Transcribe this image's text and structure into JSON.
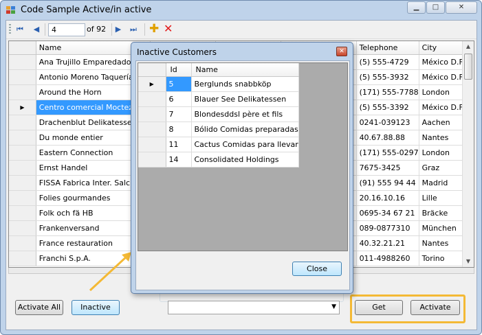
{
  "window": {
    "title": "Code Sample Active/in active",
    "buttons": {
      "minimize": "▁",
      "maximize": "□",
      "close": "✕"
    }
  },
  "navigator": {
    "position": "4",
    "count_label": "of 92",
    "icons": [
      "first-icon",
      "prev-icon",
      "next-icon",
      "last-icon",
      "add-icon",
      "delete-icon"
    ]
  },
  "grid": {
    "columns": [
      "Name",
      "",
      "",
      "",
      "Telephone",
      "City"
    ],
    "current_row": 3,
    "rows": [
      {
        "name": "Ana Trujillo Emparedados y h",
        "telephone": "(5) 555-4729",
        "city": "México D.F."
      },
      {
        "name": "Antonio Moreno Taquería",
        "telephone": "(5) 555-3932",
        "city": "México D.F."
      },
      {
        "name": "Around the Horn",
        "telephone": "(171) 555-7788",
        "city": "London"
      },
      {
        "name": "Centro comercial Moctezuma",
        "telephone": "(5) 555-3392",
        "city": "México D.F."
      },
      {
        "name": "Drachenblut Delikatessen",
        "telephone": "0241-039123",
        "city": "Aachen"
      },
      {
        "name": "Du monde entier",
        "telephone": "40.67.88.88",
        "city": "Nantes"
      },
      {
        "name": "Eastern Connection",
        "telephone": "(171) 555-0297",
        "city": "London"
      },
      {
        "name": "Ernst Handel",
        "telephone": "7675-3425",
        "city": "Graz"
      },
      {
        "name": "FISSA Fabrica Inter. Salchich",
        "telephone": "(91) 555 94 44",
        "city": "Madrid"
      },
      {
        "name": "Folies gourmandes",
        "telephone": "20.16.10.16",
        "city": "Lille"
      },
      {
        "name": "Folk och fä HB",
        "telephone": "0695-34 67 21",
        "city": "Bräcke"
      },
      {
        "name": "Frankenversand",
        "telephone": "089-0877310",
        "city": "München"
      },
      {
        "name": "France restauration",
        "telephone": "40.32.21.21",
        "city": "Nantes"
      },
      {
        "name": "Franchi S.p.A.",
        "telephone": "011-4988260",
        "city": "Torino"
      }
    ]
  },
  "buttons": {
    "activate_all": "Activate All",
    "inactive": "Inactive",
    "get": "Get",
    "activate": "Activate"
  },
  "groupbox_title": "",
  "combo_value": "",
  "dialog": {
    "title": "Inactive Customers",
    "close_glyph": "✕",
    "columns": [
      "Id",
      "Name"
    ],
    "rows": [
      {
        "id": "5",
        "name": "Berglunds snabbköp"
      },
      {
        "id": "6",
        "name": "Blauer See Delikatessen"
      },
      {
        "id": "7",
        "name": "Blondesddsl père et fils"
      },
      {
        "id": "8",
        "name": "Bólido Comidas preparadas"
      },
      {
        "id": "11",
        "name": "Cactus Comidas para llevar"
      },
      {
        "id": "14",
        "name": "Consolidated Holdings"
      }
    ],
    "close_button": "Close"
  },
  "colors": {
    "accent_highlight": "#f4b935",
    "selection": "#3399ff",
    "window_frame": "#bfd3ea"
  }
}
